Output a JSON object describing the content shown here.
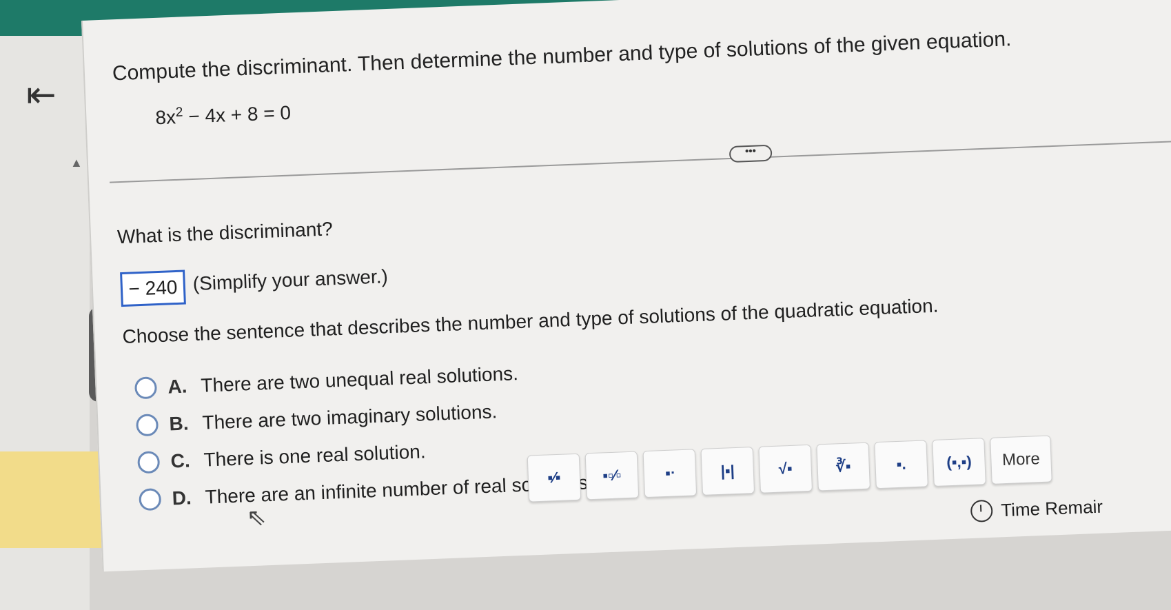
{
  "question": {
    "title": "Compute the discriminant. Then determine the number and type of solutions of the given equation.",
    "equation_base": "8x",
    "equation_exp": "2",
    "equation_rest": " − 4x + 8 = 0",
    "more_label": "•••"
  },
  "part1": {
    "prompt": "What is the discriminant?",
    "answer_value": "− 240",
    "hint": "(Simplify your answer.)"
  },
  "part2": {
    "prompt": "Choose the sentence that describes the number and type of solutions of the quadratic equation.",
    "options": [
      {
        "letter": "A.",
        "text": "There are two unequal real solutions."
      },
      {
        "letter": "B.",
        "text": "There are two imaginary solutions."
      },
      {
        "letter": "C.",
        "text": "There is one real solution."
      },
      {
        "letter": "D.",
        "text": "There are an infinite number of real solutions."
      }
    ]
  },
  "toolbar": {
    "buttons": [
      {
        "name": "fraction-tool",
        "glyph": "▪⁄▪"
      },
      {
        "name": "mixed-number-tool",
        "glyph": "▪▫⁄▫"
      },
      {
        "name": "exponent-tool",
        "glyph": "▪ᐧ"
      },
      {
        "name": "absolute-value-tool",
        "glyph": "|▪|"
      },
      {
        "name": "square-root-tool",
        "glyph": "√▪"
      },
      {
        "name": "nth-root-tool",
        "glyph": "∛▪"
      },
      {
        "name": "decimal-tool",
        "glyph": "▪."
      },
      {
        "name": "ordered-pair-tool",
        "glyph": "(▪,▪)"
      }
    ],
    "more_label": "More"
  },
  "timer": {
    "label": "Time Remair"
  },
  "icons": {
    "back": "back-to-start-icon",
    "collapse": "collapse-triangle-icon",
    "cursor": "mouse-cursor-icon",
    "clock": "clock-icon"
  }
}
